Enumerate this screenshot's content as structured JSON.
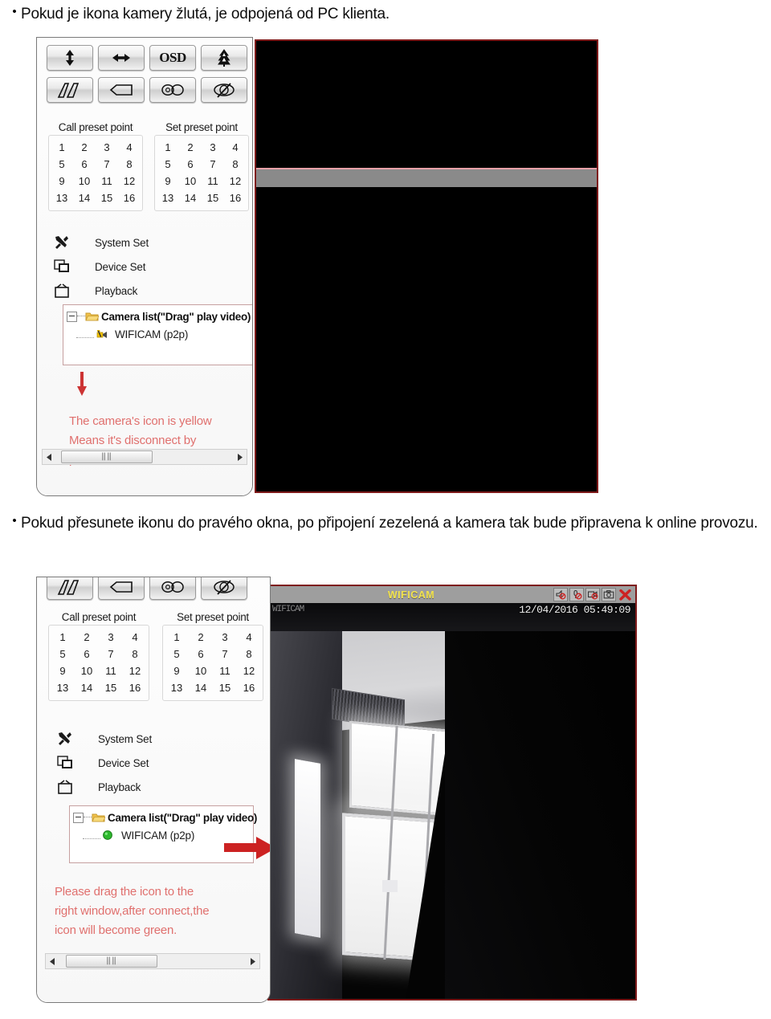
{
  "document": {
    "paragraphs": [
      {
        "bullet": "•",
        "text": "Pokud je ikona kamery žlutá, je odpojená od PC klienta."
      },
      {
        "bullet": "•",
        "text": "Pokud přesunete ikonu do pravého okna, po připojení zezelená a kamera tak bude připravena k online provozu."
      }
    ]
  },
  "screenshot_one": {
    "toolbar_row_one": [
      {
        "name": "tilt-vertical-button",
        "icon": "arrow-updown-icon",
        "label": ""
      },
      {
        "name": "pan-horizontal-button",
        "icon": "arrow-leftright-icon",
        "label": ""
      },
      {
        "name": "osd-button",
        "icon": "osd-text-icon",
        "label": "OSD"
      },
      {
        "name": "outline-tree-button",
        "icon": "tree-outline-icon",
        "label": ""
      },
      {
        "name": "solid-tree-button",
        "icon": "tree-solid-icon",
        "label": ""
      }
    ],
    "toolbar_row_two": [
      {
        "name": "mountain-button",
        "icon": "mountain-icon",
        "label": ""
      },
      {
        "name": "flag-button",
        "icon": "flag-arrow-icon",
        "label": ""
      },
      {
        "name": "infinity-button",
        "icon": "infinity-loop-icon",
        "label": ""
      },
      {
        "name": "phi-button",
        "icon": "phi-slash-icon",
        "label": ""
      }
    ],
    "presets": {
      "call": {
        "title": "Call preset point",
        "values": [
          "1",
          "2",
          "3",
          "4",
          "5",
          "6",
          "7",
          "8",
          "9",
          "10",
          "11",
          "12",
          "13",
          "14",
          "15",
          "16"
        ]
      },
      "set": {
        "title": "Set preset point",
        "values": [
          "1",
          "2",
          "3",
          "4",
          "5",
          "6",
          "7",
          "8",
          "9",
          "10",
          "11",
          "12",
          "13",
          "14",
          "15",
          "16"
        ]
      }
    },
    "menu": [
      {
        "label": "System Set",
        "icon": "tools-icon"
      },
      {
        "label": "Device Set",
        "icon": "monitors-icon"
      },
      {
        "label": "Playback",
        "icon": "tv-icon"
      }
    ],
    "tree": {
      "root_label": "Camera list(\"Drag\" play video)",
      "child_label": "WIFICAM (p2p)",
      "child_status_color": "#f2c200",
      "child_status_name": "camera-yellow-icon"
    },
    "annotation": "The camera's icon is yellow\nMeans it's disconnect by\npc client.",
    "annotation_color": "#e0706e",
    "arrow": {
      "name": "down-arrow-annotation",
      "direction": "down",
      "color": "#cc3333"
    },
    "scrollbar": {
      "left_arrow": "◄",
      "right_arrow": "►",
      "grip": "‖‖"
    },
    "video": {
      "background_color": "#000000",
      "band_color": "#8a8a8a",
      "border_color": "#7e1a1a"
    }
  },
  "screenshot_two": {
    "toolbar_row_two": [
      {
        "name": "mountain-button",
        "icon": "mountain-icon",
        "label": ""
      },
      {
        "name": "flag-button",
        "icon": "flag-arrow-icon",
        "label": ""
      },
      {
        "name": "infinity-button",
        "icon": "infinity-loop-icon",
        "label": ""
      },
      {
        "name": "phi-button",
        "icon": "phi-slash-icon",
        "label": ""
      }
    ],
    "presets": {
      "call": {
        "title": "Call preset point",
        "values": [
          "1",
          "2",
          "3",
          "4",
          "5",
          "6",
          "7",
          "8",
          "9",
          "10",
          "11",
          "12",
          "13",
          "14",
          "15",
          "16"
        ]
      },
      "set": {
        "title": "Set preset point",
        "values": [
          "1",
          "2",
          "3",
          "4",
          "5",
          "6",
          "7",
          "8",
          "9",
          "10",
          "11",
          "12",
          "13",
          "14",
          "15",
          "16"
        ]
      }
    },
    "menu": [
      {
        "label": "System Set",
        "icon": "tools-icon"
      },
      {
        "label": "Device Set",
        "icon": "monitors-icon"
      },
      {
        "label": "Playback",
        "icon": "tv-icon"
      }
    ],
    "tree": {
      "root_label": "Camera list(\"Drag\" play video)",
      "child_label": "WIFICAM (p2p)",
      "child_status_color": "#2db82d",
      "child_status_name": "camera-green-icon"
    },
    "annotation": "Please drag the icon to the\nright window,after connect,the\nicon will become green.",
    "annotation_color": "#e0706e",
    "arrow": {
      "name": "right-arrow-annotation",
      "direction": "right",
      "color": "#cc2222"
    },
    "scrollbar": {
      "left_arrow": "◄",
      "right_arrow": "►",
      "grip": "‖‖"
    },
    "video": {
      "title": "WIFICAM",
      "title_color": "#f2e34d",
      "osd_left": "WIFICAM",
      "timestamp": "12/04/2016 05:49:09",
      "border_color": "#7e1a1a",
      "controls": [
        {
          "name": "speaker-mute-icon",
          "label": ""
        },
        {
          "name": "microphone-mute-icon",
          "label": ""
        },
        {
          "name": "record-off-icon",
          "label": ""
        },
        {
          "name": "snapshot-camera-icon",
          "label": ""
        },
        {
          "name": "close-x-icon",
          "label": ""
        }
      ]
    }
  }
}
